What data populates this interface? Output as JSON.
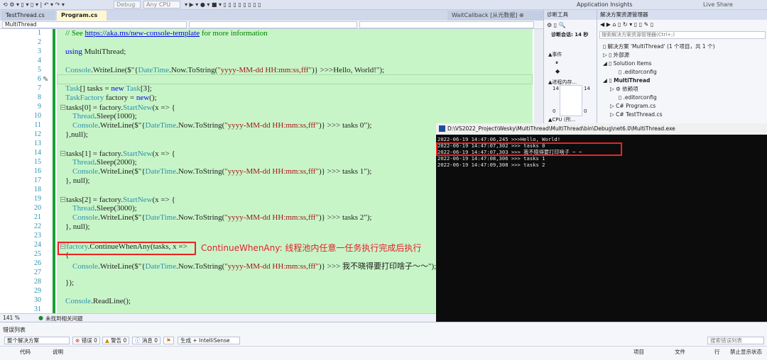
{
  "toolbar": {
    "debug": "Debug",
    "cpu": "Any CPU",
    "insights": "Application Insights",
    "live_share": "Live Share"
  },
  "tabs": [
    {
      "label": "TestThread.cs"
    },
    {
      "label": "Program.cs"
    }
  ],
  "tab_pin": "⊕ ✕",
  "waitcallback_tab": "WaitCallback [从元数据] ⊕",
  "nav": {
    "project": "MultiThread"
  },
  "editor": {
    "line_numbers": [
      "1",
      "2",
      "3",
      "4",
      "5",
      "6",
      "7",
      "8",
      "9",
      "10",
      "11",
      "12",
      "13",
      "14",
      "15",
      "16",
      "17",
      "18",
      "19",
      "20",
      "21",
      "22",
      "23",
      "24",
      "25",
      "26",
      "27",
      "28",
      "29",
      "30",
      "31"
    ],
    "zoom": "141 %",
    "status": "未找到相关问题"
  },
  "code": {
    "l1a": "// See ",
    "l1b": "https://aka.ms/new-console-template",
    "l1c": " for more information",
    "l3a": "using ",
    "l3b": "MultiThread;",
    "l5a": "Console",
    "l5b": ".WriteLine($\"{",
    "l5c": "DateTime",
    "l5d": ".Now.ToString(",
    "l5e": "\"yyyy-MM-dd HH:mm:ss,fff\"",
    "l5f": ")} >>>Hello, World!\");",
    "l7a": "Task",
    "l7b": "[] tasks = ",
    "l7c": "new ",
    "l7d": "Task",
    "l7e": "[3];",
    "l8a": "TaskFactory",
    "l8b": " factory = ",
    "l8c": "new",
    "l8d": "();",
    "l9": "tasks[0] = factory.",
    "l9b": "StartNew",
    "l9c": "(x => {",
    "l10a": "Thread",
    "l10b": ".Sleep(1000);",
    "l11a": "Console",
    "l11b": ".WriteLine($\"{",
    "l11c": "DateTime",
    "l11d": ".Now.ToString(",
    "l11e": "\"yyyy-MM-dd HH:mm:ss,fff\"",
    "l11f": ")} >>> tasks 0\");",
    "l12": "},null);",
    "l14": "tasks[1] = factory.",
    "l14b": "StartNew",
    "l14c": "(x => {",
    "l15a": "Thread",
    "l15b": ".Sleep(2000);",
    "l16f": ")} >>> tasks 1\");",
    "l17": "}, null);",
    "l19": "tasks[2] = factory.",
    "l19b": "StartNew",
    "l19c": "(x => {",
    "l20a": "Thread",
    "l20b": ".Sleep(3000);",
    "l21f": ")} >>> tasks 2\");",
    "l22": "}, null);",
    "l24a": "factory",
    "l24b": ".ContinueWhenAny(tasks, x =>",
    "l25": "{",
    "l26f": ")} >>> 我不晓得要打印啥子～～\");",
    "l28": "});",
    "l30a": "Console",
    "l30b": ".ReadLine();"
  },
  "annotation": "ContinueWhenAny: 线程池内任意一任务执行完成后执行",
  "diag": {
    "title": "诊断工具",
    "session": "诊断会话: 14 秒",
    "events": "▲事件",
    "mem": "▲进程内存...",
    "v14a": "14",
    "v14b": "14",
    "v0a": "0",
    "v0b": "0",
    "cpu": "▲CPU (所..."
  },
  "solution": {
    "title": "解决方案资源管理器",
    "search": "搜索解决方案资源管理器(Ctrl+;)",
    "items": [
      "解决方案 'MultiThread' (1 个项目，共 1 个)",
      "外部源",
      "Solution Items",
      ".editorconfig",
      "MultiThread",
      "依赖项",
      ".editorconfig",
      "Program.cs",
      "TestThread.cs"
    ]
  },
  "console": {
    "title": "D:\\VS2022_Project\\Wesky\\MultiThread\\MultiThread\\bin\\Debug\\net6.0\\MultiThread.exe",
    "lines": [
      "2022-06-19 14:47:06,245 >>>Hello, World!",
      "2022-06-19 14:47:07,302 >>> tasks 0",
      "2022-06-19 14:47:07,303 >>> 我不晓得要打印啥子 ~ ~",
      "2022-06-19 14:47:08,306 >>> tasks 1",
      "2022-06-19 14:47:09,308 >>> tasks 2"
    ]
  },
  "errors": {
    "title": "错误列表",
    "scope": "整个解决方案",
    "err": "错误 0",
    "warn": "警告 0",
    "msg": "消息 0",
    "build": "生成 + IntelliSense",
    "search": "搜索错误列表",
    "cols": [
      "代码",
      "说明",
      "项目",
      "文件",
      "行",
      "禁止显示状态"
    ]
  },
  "colors": {
    "code_bg": "#c8f5c8",
    "annotation": "#e4202a",
    "changebar": "#17a233"
  }
}
